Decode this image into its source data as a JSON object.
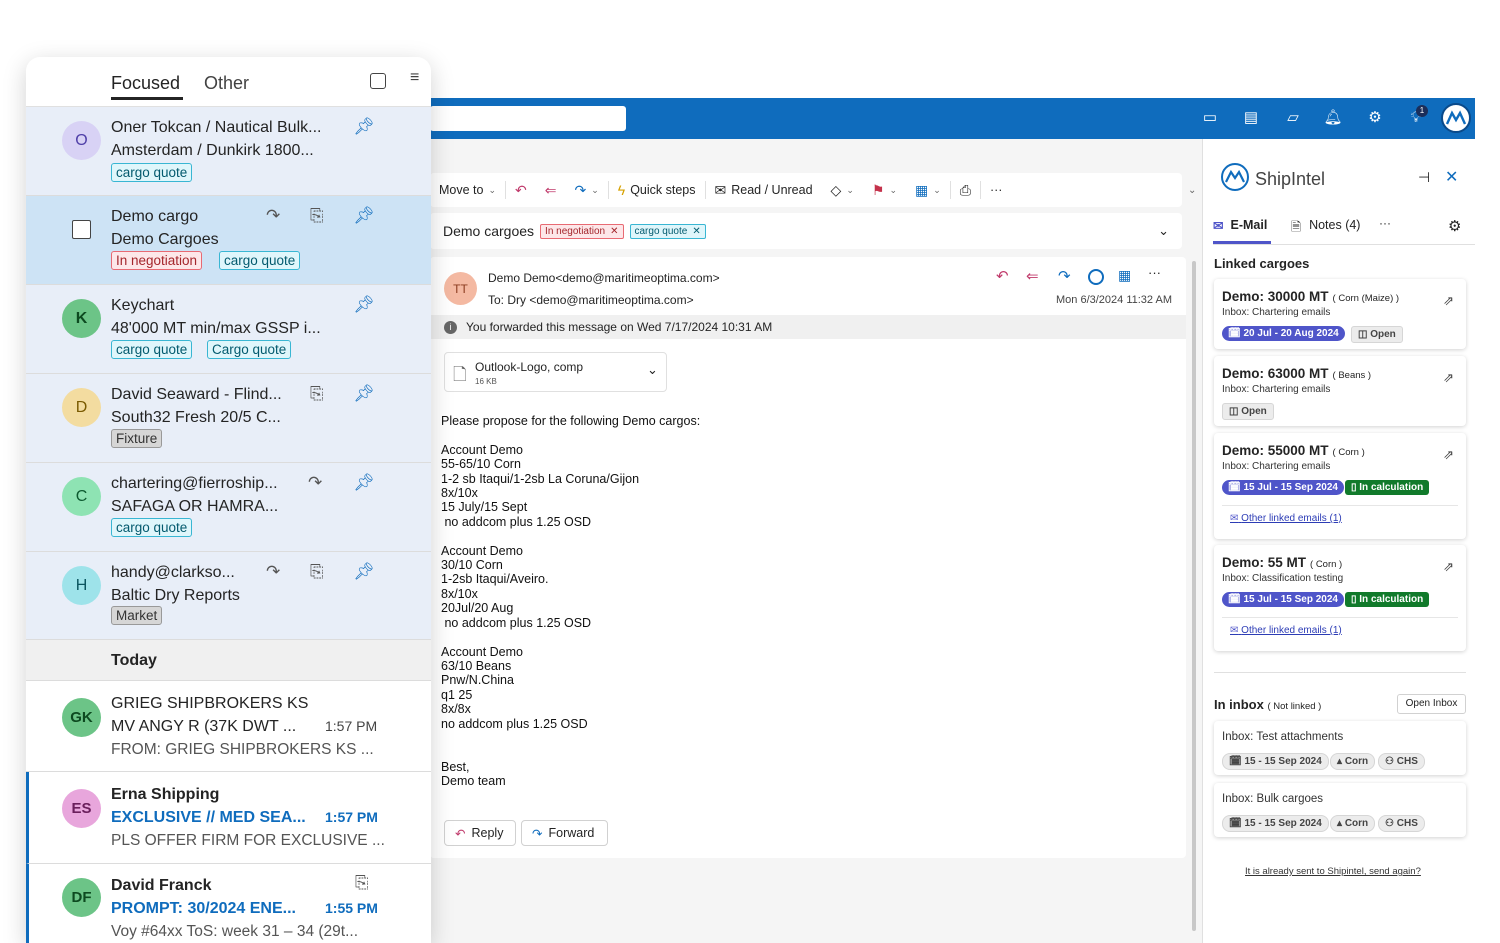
{
  "left_panel": {
    "tabs": [
      {
        "label": "Focused"
      },
      {
        "label": "Other"
      }
    ],
    "messages": [
      {
        "initial": "O",
        "from": "Oner Tokcan / Nautical Bulk...",
        "subject": "Amsterdam / Dunkirk 1800...",
        "tags": [
          "cargo quote"
        ]
      },
      {
        "from": "Demo cargo",
        "subject": "Demo Cargoes",
        "tags": [
          "In negotiation",
          "cargo quote"
        ]
      },
      {
        "initial": "K",
        "from": "Keychart",
        "subject": "48'000 MT min/max GSSP i...",
        "tags": [
          "cargo quote",
          "Cargo quote"
        ]
      },
      {
        "initial": "D",
        "from": "David Seaward - Flind...",
        "subject": "South32 Fresh 20/5 C...",
        "tags": [
          "Fixture"
        ]
      },
      {
        "initial": "C",
        "from": "chartering@fierroship...",
        "subject": "SAFAGA OR HAMRA...",
        "tags": [
          "cargo quote"
        ]
      },
      {
        "initial": "H",
        "from": "handy@clarkso...",
        "subject": "Baltic Dry Reports",
        "tags": [
          "Market"
        ]
      }
    ],
    "section_today": "Today",
    "today_messages": [
      {
        "initial": "GK",
        "from": "GRIEG SHIPBROKERS KS",
        "subject": "MV ANGY R (37K DWT ...",
        "time": "1:57 PM",
        "preview": "FROM: GRIEG SHIPBROKERS KS ..."
      },
      {
        "initial": "ES",
        "from": "Erna Shipping",
        "subject": "EXCLUSIVE // MED SEA...",
        "time": "1:57 PM",
        "preview": "PLS OFFER FIRM FOR EXCLUSIVE ..."
      },
      {
        "initial": "DF",
        "from": "David Franck",
        "subject": "PROMPT: 30/2024 ENE...",
        "time": "1:55 PM",
        "preview": "Voy #64xx ToS: week 31 – 34 (29t..."
      }
    ]
  },
  "toolbar": {
    "move_to": "Move to",
    "quick_steps": "Quick steps",
    "read_unread": "Read / Unread",
    "more": "···"
  },
  "conversation": {
    "title": "Demo cargoes",
    "tags": [
      "In negotiation",
      "cargo quote"
    ]
  },
  "email": {
    "avatar": "TT",
    "from": "Demo Demo<demo@maritimeoptima.com>",
    "to": "To:  Dry <demo@maritimeoptima.com>",
    "date": "Mon 6/3/2024 11:32 AM",
    "forward_notice": "You forwarded this message on Wed 7/17/2024 10:31 AM",
    "attachment_name": "Outlook-Logo, comp",
    "attachment_size": "16 KB",
    "body": "Please propose for the following Demo cargos:\n\nAccount Demo\n55-65/10 Corn\n1-2 sb Itaqui/1-2sb La Coruna/Gijon\n8x/10x\n15 July/15 Sept\n no addcom plus 1.25 OSD\n\nAccount Demo\n30/10 Corn\n1-2sb Itaqui/Aveiro.\n8x/10x\n20Jul/20 Aug\n no addcom plus 1.25 OSD\n\nAccount Demo\n63/10 Beans\nPnw/N.China\nq1 25\n8x/8x\nno addcom plus 1.25 OSD\n\n\nBest,\nDemo team",
    "reply": "Reply",
    "forward": "Forward"
  },
  "shipintel": {
    "title": "ShipIntel",
    "tabs": [
      {
        "label": "E-Mail"
      },
      {
        "label": "Notes (4)"
      }
    ],
    "more": "···",
    "linked_heading": "Linked cargoes",
    "linked": [
      {
        "title": "Demo: 30000 MT",
        "cargo": "( Corn (Maize) )",
        "inbox": "Inbox: Chartering emails",
        "date": "20 Jul - 20 Aug 2024",
        "status": "Open"
      },
      {
        "title": "Demo: 63000 MT",
        "cargo": "( Beans )",
        "inbox": "Inbox: Chartering emails",
        "status": "Open"
      },
      {
        "title": "Demo: 55000 MT",
        "cargo": "( Corn )",
        "inbox": "Inbox: Chartering emails",
        "date": "15 Jul - 15 Sep 2024",
        "status": "In calculation",
        "link": "Other linked emails (1)"
      },
      {
        "title": "Demo: 55 MT",
        "cargo": "( Corn )",
        "inbox": "Inbox: Classification testing",
        "date": "15 Jul - 15 Sep 2024",
        "status": "In calculation",
        "link": "Other linked emails (1)"
      }
    ],
    "in_inbox_heading": "In inbox",
    "in_inbox_note": "( Not linked )",
    "open_inbox": "Open Inbox",
    "unlinked": [
      {
        "inbox": "Inbox: Test attachments",
        "date": "15 - 15 Sep 2024",
        "cargo": "Corn",
        "unit": "CHS"
      },
      {
        "inbox": "Inbox: Bulk cargoes",
        "date": "15 - 15 Sep 2024",
        "cargo": "Corn",
        "unit": "CHS"
      }
    ],
    "resend": "It is already sent to Shipintel, send again?"
  },
  "notifications_badge": "1",
  "colors": {
    "brand": "#0f6cbd",
    "accent_blue": "#4f55c9",
    "status_green": "#117a2b"
  }
}
